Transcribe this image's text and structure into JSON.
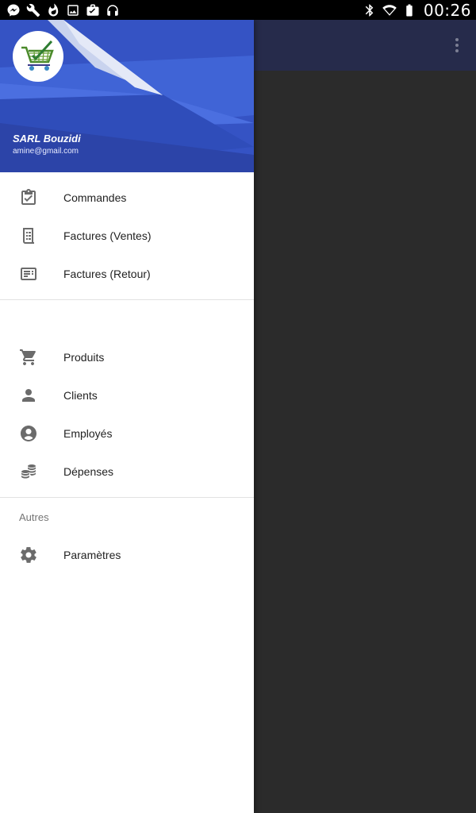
{
  "status_bar": {
    "time": "00:26",
    "left_icons": [
      "messenger-icon",
      "wrench-icon",
      "flame-icon",
      "image-icon",
      "briefcase-icon",
      "headphones-icon"
    ],
    "right_icons": [
      "bluetooth-icon",
      "wifi-icon",
      "battery-icon"
    ]
  },
  "drawer": {
    "header": {
      "name": "SARL Bouzidi",
      "email": "amine@gmail.com",
      "colors": {
        "primary": "#3553c4",
        "light": "#4c6ce0",
        "dark": "#2c44a8"
      }
    },
    "group1": [
      {
        "label": "Commandes",
        "icon": "clipboard-check-icon"
      },
      {
        "label": "Factures (Ventes)",
        "icon": "receipt-icon"
      },
      {
        "label": "Factures (Retour)",
        "icon": "card-list-icon"
      }
    ],
    "group2": [
      {
        "label": "Produits",
        "icon": "cart-icon"
      },
      {
        "label": "Clients",
        "icon": "person-icon"
      },
      {
        "label": "Employés",
        "icon": "account-circle-icon"
      },
      {
        "label": "Dépenses",
        "icon": "coins-icon"
      }
    ],
    "others": {
      "section_label": "Autres",
      "items": [
        {
          "label": "Paramètres",
          "icon": "gear-icon"
        }
      ]
    }
  },
  "app": {
    "toolbar_color": "#262b4b",
    "overflow_icon": "more-vert-icon"
  }
}
